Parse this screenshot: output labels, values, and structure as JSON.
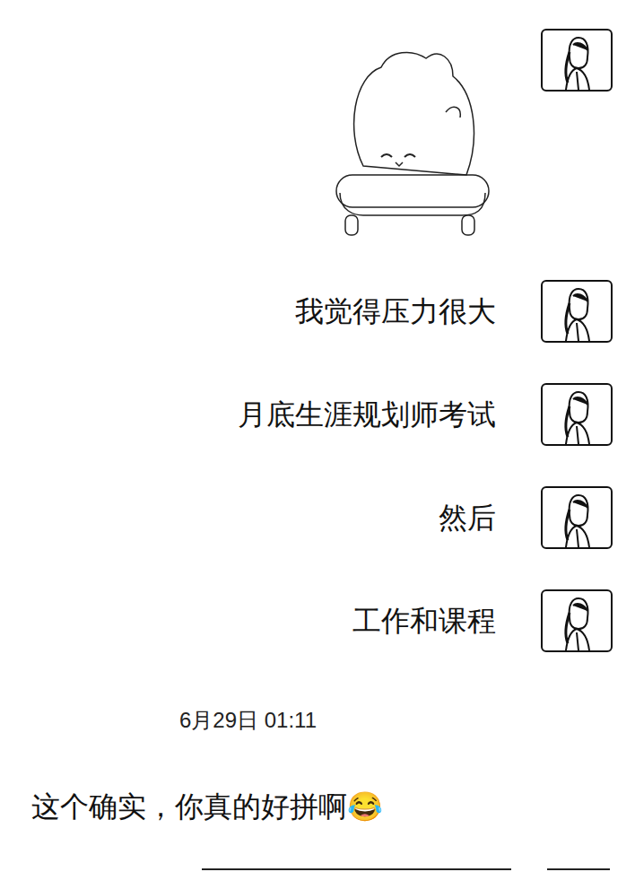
{
  "messages": [
    {
      "kind": "sticker",
      "sender": "self",
      "text": ""
    },
    {
      "kind": "text",
      "sender": "self",
      "text": "我觉得压力很大"
    },
    {
      "kind": "text",
      "sender": "self",
      "text": "月底生涯规划师考试"
    },
    {
      "kind": "text",
      "sender": "self",
      "text": "然后"
    },
    {
      "kind": "text",
      "sender": "self",
      "text": "工作和课程"
    }
  ],
  "timestamp": "6月29日 01:11",
  "reply": {
    "kind": "text",
    "sender": "friend",
    "text": "这个确实，你真的好拼啊😂"
  }
}
